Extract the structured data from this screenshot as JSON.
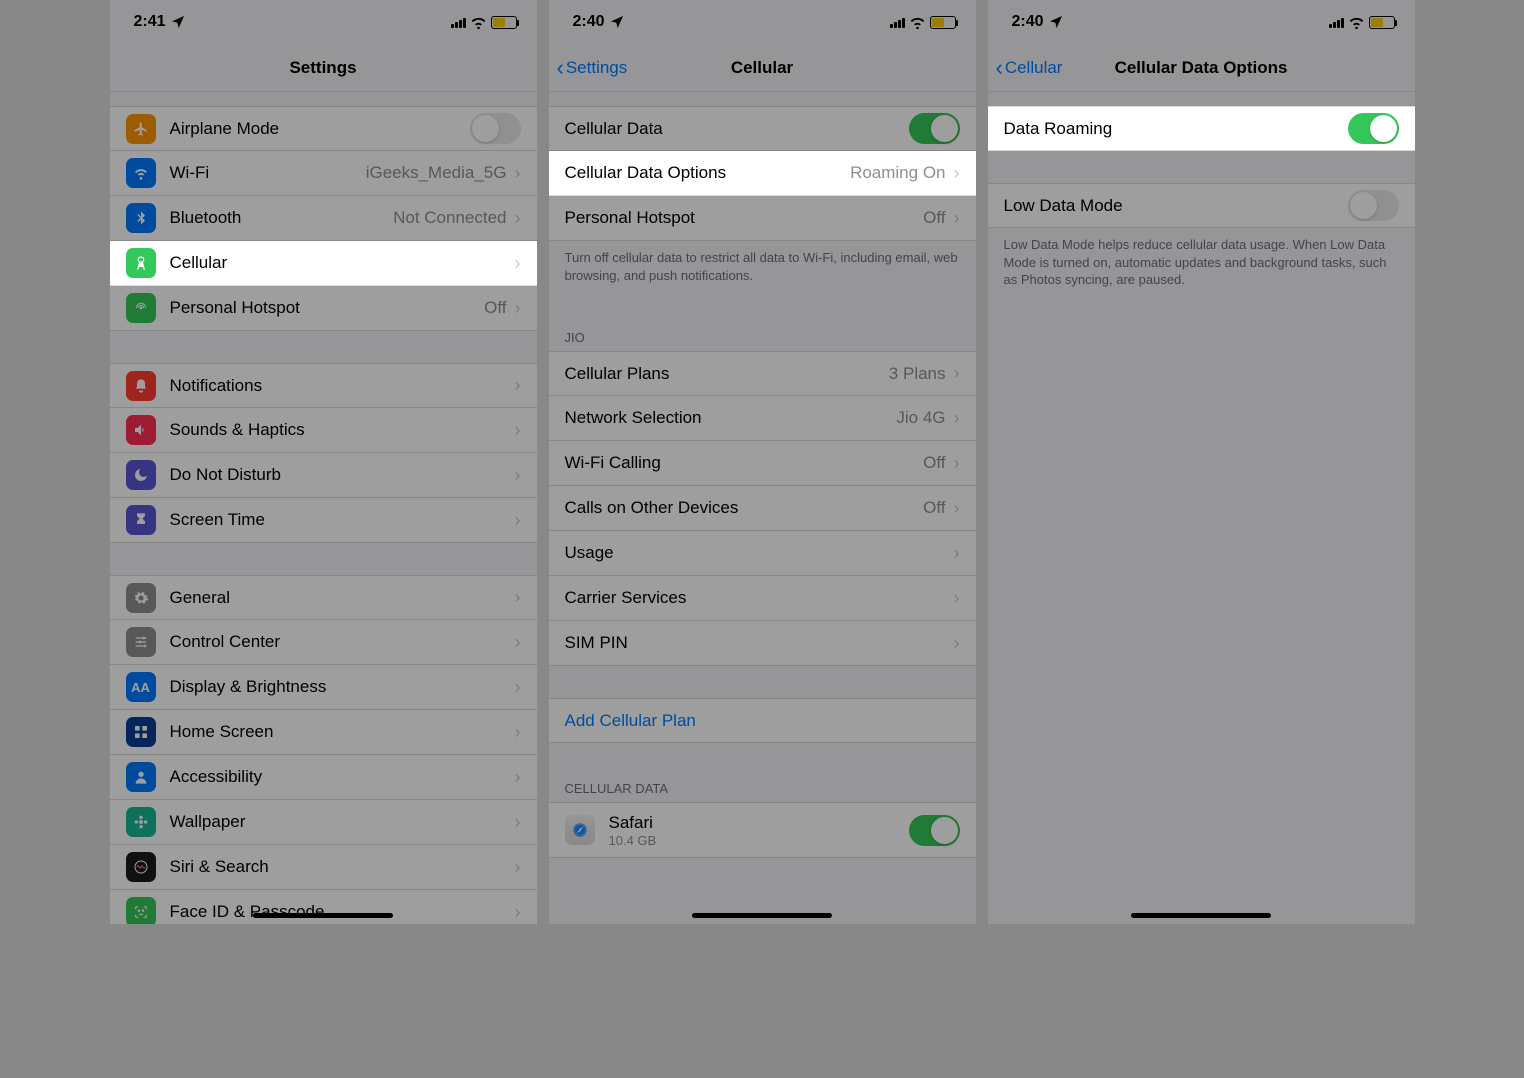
{
  "screens": [
    {
      "time": "2:41",
      "title": "Settings",
      "back": null,
      "sections": [
        {
          "rows": [
            {
              "icon": "airplane",
              "iconbg": "bg-orange",
              "label": "Airplane Mode",
              "type": "toggle",
              "on": false
            },
            {
              "icon": "wifi",
              "iconbg": "bg-blue",
              "label": "Wi-Fi",
              "value": "iGeeks_Media_5G",
              "type": "nav"
            },
            {
              "icon": "bluetooth",
              "iconbg": "bg-blue",
              "label": "Bluetooth",
              "value": "Not Connected",
              "type": "nav"
            },
            {
              "icon": "antenna",
              "iconbg": "bg-green",
              "label": "Cellular",
              "type": "nav",
              "highlight": true
            },
            {
              "icon": "hotspot",
              "iconbg": "bg-green",
              "label": "Personal Hotspot",
              "value": "Off",
              "type": "nav"
            }
          ]
        },
        {
          "rows": [
            {
              "icon": "bell",
              "iconbg": "bg-red",
              "label": "Notifications",
              "type": "nav"
            },
            {
              "icon": "speaker",
              "iconbg": "bg-pink",
              "label": "Sounds & Haptics",
              "type": "nav"
            },
            {
              "icon": "moon",
              "iconbg": "bg-purple",
              "label": "Do Not Disturb",
              "type": "nav"
            },
            {
              "icon": "hourglass",
              "iconbg": "bg-purple",
              "label": "Screen Time",
              "type": "nav"
            }
          ]
        },
        {
          "rows": [
            {
              "icon": "gear",
              "iconbg": "bg-gray",
              "label": "General",
              "type": "nav"
            },
            {
              "icon": "sliders",
              "iconbg": "bg-gray",
              "label": "Control Center",
              "type": "nav"
            },
            {
              "icon": "aa",
              "iconbg": "bg-blue",
              "label": "Display & Brightness",
              "type": "nav"
            },
            {
              "icon": "grid",
              "iconbg": "bg-darkblue",
              "label": "Home Screen",
              "type": "nav"
            },
            {
              "icon": "person",
              "iconbg": "bg-blue",
              "label": "Accessibility",
              "type": "nav"
            },
            {
              "icon": "flower",
              "iconbg": "bg-teal",
              "label": "Wallpaper",
              "type": "nav"
            },
            {
              "icon": "siri",
              "iconbg": "bg-black",
              "label": "Siri & Search",
              "type": "nav"
            },
            {
              "icon": "faceid",
              "iconbg": "bg-green",
              "label": "Face ID & Passcode",
              "type": "nav"
            }
          ]
        }
      ]
    },
    {
      "time": "2:40",
      "title": "Cellular",
      "back": "Settings",
      "sections": [
        {
          "rows": [
            {
              "label": "Cellular Data",
              "type": "toggle",
              "on": true
            },
            {
              "label": "Cellular Data Options",
              "value": "Roaming On",
              "type": "nav",
              "highlight": true
            },
            {
              "label": "Personal Hotspot",
              "value": "Off",
              "type": "nav"
            }
          ],
          "footer": "Turn off cellular data to restrict all data to Wi-Fi, including email, web browsing, and push notifications."
        },
        {
          "header": "JIO",
          "rows": [
            {
              "label": "Cellular Plans",
              "value": "3 Plans",
              "type": "nav"
            },
            {
              "label": "Network Selection",
              "value": "Jio 4G",
              "type": "nav"
            },
            {
              "label": "Wi-Fi Calling",
              "value": "Off",
              "type": "nav"
            },
            {
              "label": "Calls on Other Devices",
              "value": "Off",
              "type": "nav"
            },
            {
              "label": "Usage",
              "type": "nav"
            },
            {
              "label": "Carrier Services",
              "type": "nav"
            },
            {
              "label": "SIM PIN",
              "type": "nav"
            }
          ]
        },
        {
          "rows": [
            {
              "label": "Add Cellular Plan",
              "type": "link"
            }
          ]
        },
        {
          "header": "CELLULAR DATA",
          "rows": [
            {
              "label": "Safari",
              "sub": "10.4 GB",
              "type": "app-toggle",
              "on": true,
              "icon": "safari"
            }
          ]
        }
      ]
    },
    {
      "time": "2:40",
      "title": "Cellular Data Options",
      "back": "Cellular",
      "sections": [
        {
          "rows": [
            {
              "label": "Data Roaming",
              "type": "toggle",
              "on": true,
              "highlight": true
            }
          ]
        },
        {
          "rows": [
            {
              "label": "Low Data Mode",
              "type": "toggle",
              "on": false
            }
          ],
          "footer": "Low Data Mode helps reduce cellular data usage. When Low Data Mode is turned on, automatic updates and background tasks, such as Photos syncing, are paused."
        }
      ]
    }
  ]
}
